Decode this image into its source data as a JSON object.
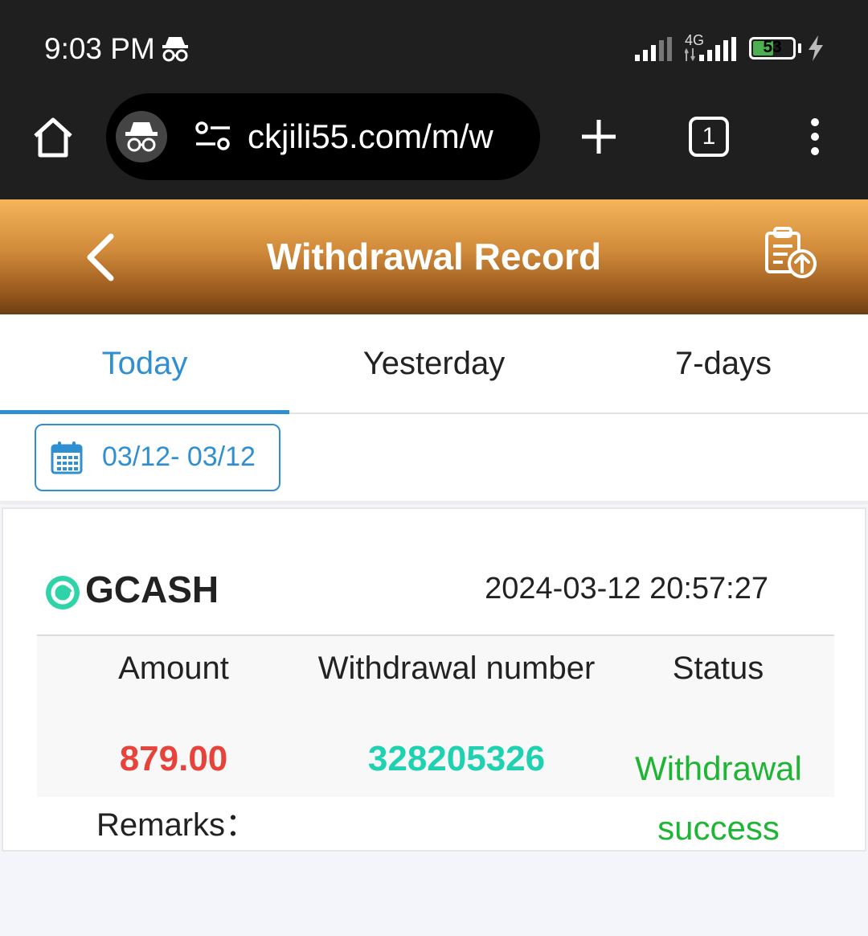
{
  "status_bar": {
    "time": "9:03 PM",
    "network": "4G",
    "battery": "53",
    "battery_fraction": 0.53
  },
  "browser": {
    "url": "ckjili55.com/m/w",
    "tab_count": "1"
  },
  "header": {
    "title": "Withdrawal Record"
  },
  "tabs": [
    {
      "label": "Today",
      "active": true
    },
    {
      "label": "Yesterday",
      "active": false
    },
    {
      "label": "7-days",
      "active": false
    }
  ],
  "filter": {
    "date_range": "03/12- 03/12"
  },
  "record": {
    "method": "GCASH",
    "datetime": "2024-03-12 20:57:27",
    "columns": {
      "amount": "Amount",
      "number": "Withdrawal number",
      "status": "Status"
    },
    "amount": "879.00",
    "number": "328205326",
    "status": "Withdrawal success",
    "remarks_label": "Remarks："
  },
  "colors": {
    "accent_blue": "#2f8fd1",
    "amount_red": "#e8433a",
    "number_teal": "#1ed1b0",
    "status_green": "#1fb534",
    "header_gold": "#d08a3a"
  }
}
